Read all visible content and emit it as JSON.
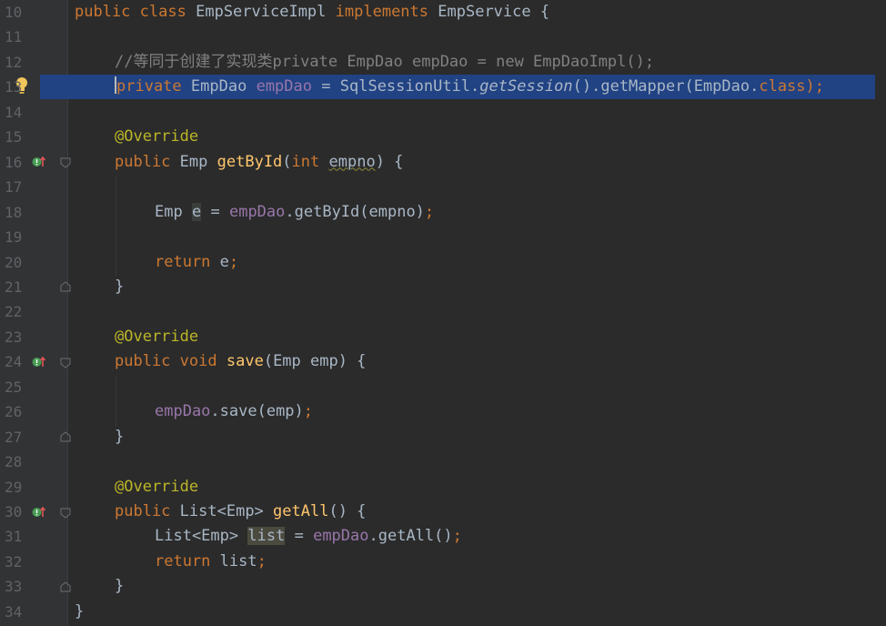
{
  "editor": {
    "language": "java",
    "highlighted_line": 13,
    "line_numbers": [
      "10",
      "11",
      "12",
      "13",
      "14",
      "15",
      "16",
      "17",
      "18",
      "19",
      "20",
      "21",
      "22",
      "23",
      "24",
      "25",
      "26",
      "27",
      "28",
      "29",
      "30",
      "31",
      "32",
      "33",
      "34"
    ],
    "code": {
      "l10": {
        "public": "public",
        "class": "class",
        "name": "EmpServiceImpl",
        "implements": "implements",
        "iface": "EmpService",
        "brace": "{"
      },
      "l12": {
        "comment": "//等同于创建了实现类private EmpDao empDao = new EmpDaoImpl();"
      },
      "l13": {
        "private": "private",
        "type": "EmpDao",
        "field": "empDao",
        "eq": "=",
        "cls": "SqlSessionUtil.",
        "method": "getSession",
        "rest": "().getMapper(EmpDao.",
        "classkw": "class",
        "end": ");"
      },
      "l15": {
        "annotation": "@Override"
      },
      "l16": {
        "public": "public",
        "type": "Emp",
        "method": "getById",
        "paren": "(",
        "int": "int",
        "param": "empno",
        "close": ") {"
      },
      "l18": {
        "type": "Emp",
        "var": "e",
        "eq": "=",
        "field": "empDao",
        "call": ".getById(empno)",
        "semi": ";"
      },
      "l20": {
        "return": "return",
        "var": "e",
        "semi": ";"
      },
      "l21": {
        "brace": "}"
      },
      "l23": {
        "annotation": "@Override"
      },
      "l24": {
        "public": "public",
        "void": "void",
        "method": "save",
        "sig": "(Emp emp) {"
      },
      "l26": {
        "field": "empDao",
        "call": ".save(emp)",
        "semi": ";"
      },
      "l27": {
        "brace": "}"
      },
      "l29": {
        "annotation": "@Override"
      },
      "l30": {
        "public": "public",
        "type": "List<Emp>",
        "method": "getAll",
        "sig": "() {"
      },
      "l31": {
        "type": "List<Emp>",
        "var": "list",
        "eq": "=",
        "field": "empDao",
        "call": ".getAll()",
        "semi": ";"
      },
      "l32": {
        "return": "return",
        "var": "list",
        "semi": ";"
      },
      "l33": {
        "brace": "}"
      },
      "l34": {
        "brace": "}"
      }
    },
    "colors": {
      "background": "#2b2b2b",
      "keyword": "#cc7832",
      "comment": "#808080",
      "annotation": "#bbb529",
      "method": "#ffc66d",
      "field": "#9876aa",
      "selection": "#214283"
    },
    "icons": {
      "intention": "lightbulb-icon",
      "override": "implements-method-icon",
      "fold": "fold-marker-icon"
    }
  }
}
